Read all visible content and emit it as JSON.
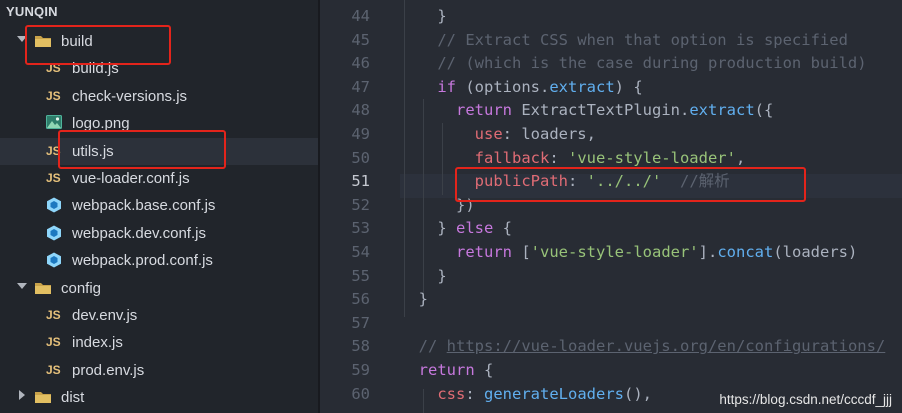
{
  "explorer": {
    "project_title": "YUNQIN",
    "items": [
      {
        "label": "build",
        "type": "folder",
        "expanded": true
      },
      {
        "label": "build.js",
        "type": "js"
      },
      {
        "label": "check-versions.js",
        "type": "js"
      },
      {
        "label": "logo.png",
        "type": "image"
      },
      {
        "label": "utils.js",
        "type": "js",
        "selected": true
      },
      {
        "label": "vue-loader.conf.js",
        "type": "js"
      },
      {
        "label": "webpack.base.conf.js",
        "type": "webpack"
      },
      {
        "label": "webpack.dev.conf.js",
        "type": "webpack"
      },
      {
        "label": "webpack.prod.conf.js",
        "type": "webpack"
      },
      {
        "label": "config",
        "type": "folder",
        "expanded": true
      },
      {
        "label": "dev.env.js",
        "type": "js"
      },
      {
        "label": "index.js",
        "type": "js"
      },
      {
        "label": "prod.env.js",
        "type": "js"
      },
      {
        "label": "dist",
        "type": "folder",
        "expanded": false
      }
    ],
    "js_badge": "JS"
  },
  "editor": {
    "active_line": "51",
    "lines": [
      {
        "num": "44",
        "text": "    }"
      },
      {
        "num": "45",
        "text": "    // Extract CSS when that option is specified"
      },
      {
        "num": "46",
        "text": "    // (which is the case during production build)"
      },
      {
        "num": "47",
        "text": "    if (options.extract) {"
      },
      {
        "num": "48",
        "text": "      return ExtractTextPlugin.extract({"
      },
      {
        "num": "49",
        "text": "        use: loaders,"
      },
      {
        "num": "50",
        "text": "        fallback: 'vue-style-loader',"
      },
      {
        "num": "51",
        "text": "        publicPath: '../../'  //解析"
      },
      {
        "num": "52",
        "text": "      })"
      },
      {
        "num": "53",
        "text": "    } else {"
      },
      {
        "num": "54",
        "text": "      return ['vue-style-loader'].concat(loaders)"
      },
      {
        "num": "55",
        "text": "    }"
      },
      {
        "num": "56",
        "text": "  }"
      },
      {
        "num": "57",
        "text": ""
      },
      {
        "num": "58",
        "text": "  // https://vue-loader.vuejs.org/en/configurations/"
      },
      {
        "num": "59",
        "text": "  return {"
      },
      {
        "num": "60",
        "text": "    css: generateLoaders(),"
      }
    ]
  },
  "watermark": "https://blog.csdn.net/cccdf_jjj",
  "colors": {
    "annotation_red": "#e3241b",
    "js_yellow": "#e5c07b",
    "keyword": "#c678dd",
    "function": "#61afef",
    "string": "#98c379",
    "comment": "#5c6370"
  }
}
